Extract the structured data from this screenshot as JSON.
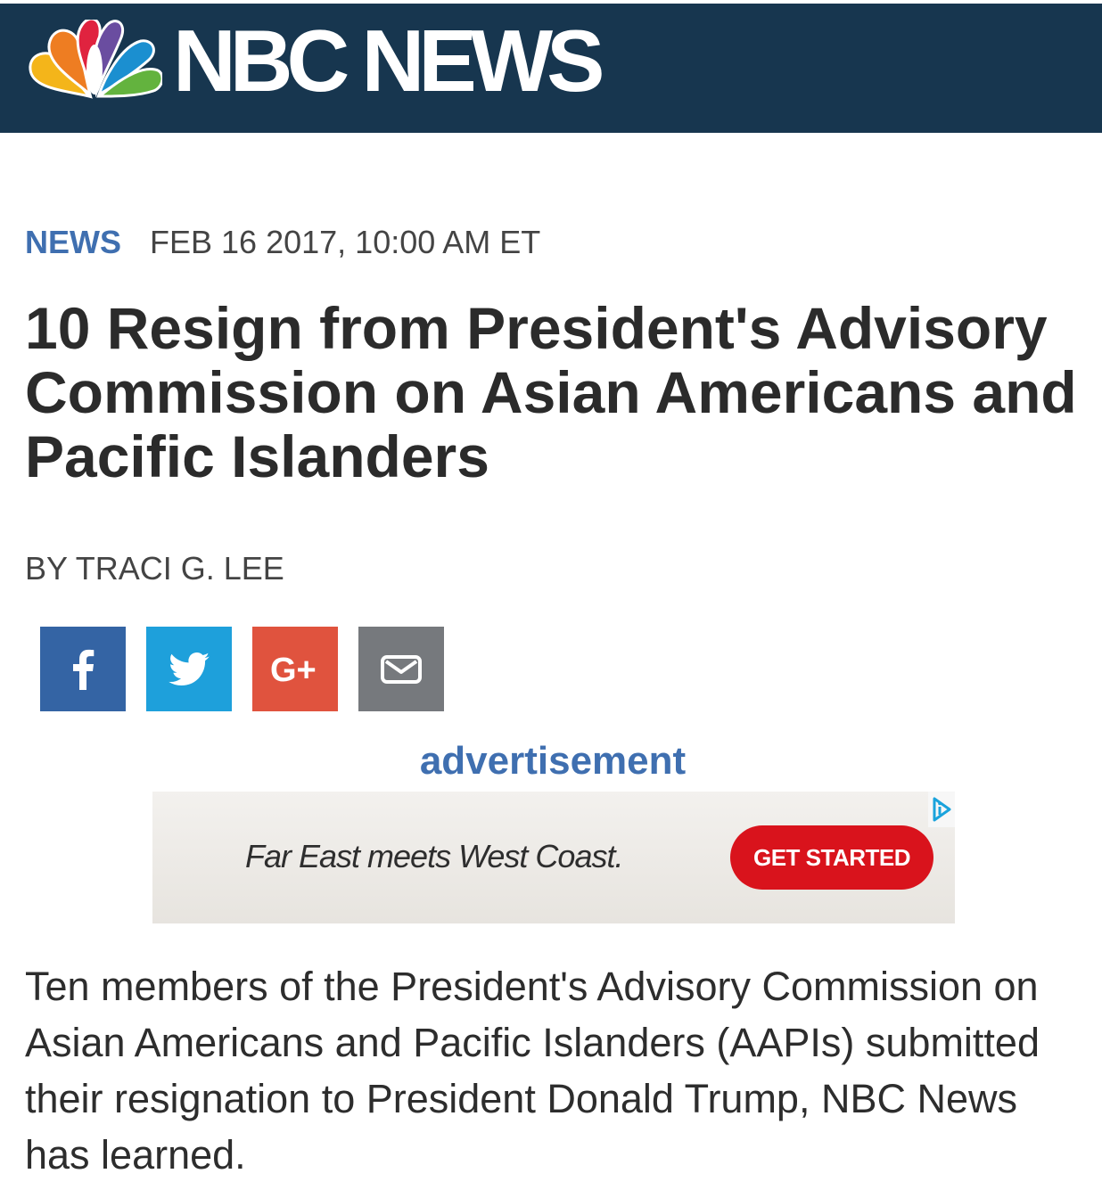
{
  "header": {
    "logo_text": "NBC NEWS",
    "logo_icon": "nbc-peacock-icon"
  },
  "article": {
    "section": "NEWS",
    "date": "FEB 16 2017, 10:00 AM ET",
    "headline": "10 Resign from President's Advisory Commission on Asian Americans and Pacific Islanders",
    "byline": "BY TRACI G. LEE",
    "body": "Ten members of the President's Advisory Commission on Asian Americans and Pacific Islanders (AAPIs) submitted their resignation to President Donald Trump, NBC News has learned."
  },
  "share": {
    "buttons": [
      {
        "icon": "facebook-icon",
        "color": "#3464a4"
      },
      {
        "icon": "twitter-icon",
        "color": "#1ea0db"
      },
      {
        "icon": "google-plus-icon",
        "label": "G+",
        "color": "#e0533e"
      },
      {
        "icon": "email-icon",
        "color": "#76797d"
      }
    ]
  },
  "ad": {
    "label": "advertisement",
    "tagline": "Far East meets West Coast.",
    "cta": "GET STARTED",
    "cta_color": "#d9131c",
    "adchoices_icon": "adchoices-icon"
  },
  "colors": {
    "header_bg": "#17364f",
    "accent_blue": "#3f6fb0"
  }
}
